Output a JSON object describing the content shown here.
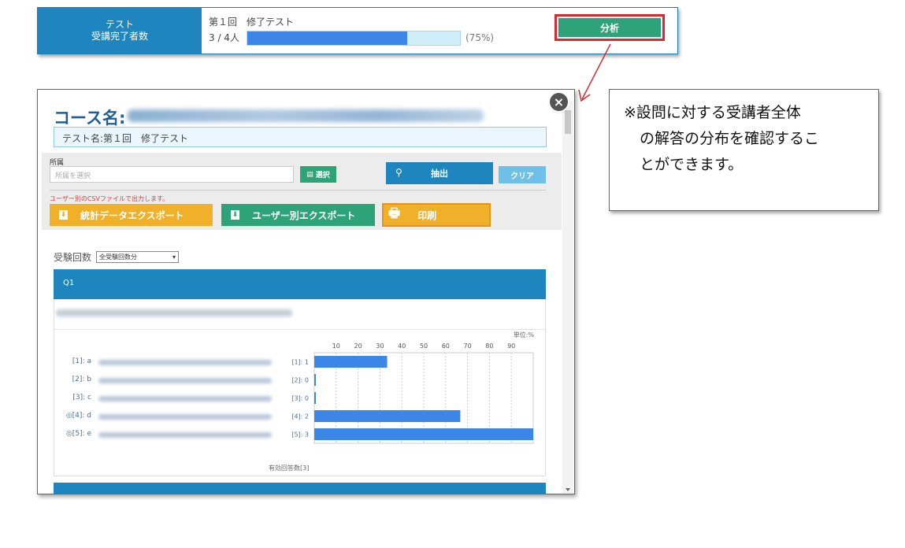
{
  "summary": {
    "label_line1": "テスト",
    "label_line2": "受講完了者数",
    "test_name": "第１回　修了テスト",
    "count": "3 / 4人",
    "progress_fraction": 0.75,
    "percent_text": "(75%)",
    "analyze_label": "分析"
  },
  "modal": {
    "close_glyph": "×",
    "course_prefix": "コース名:",
    "test_name": "テスト名:第１回　修了テスト",
    "filter": {
      "affiliation_label": "所属",
      "affiliation_placeholder": "所属を選択",
      "select_label": "選択",
      "extract_label": "抽出",
      "clear_label": "クリア",
      "csv_note": "ユーザー別のCSVファイルで出力します。",
      "stats_export_label": "統計データエクスポート",
      "user_export_label": "ユーザー別エクスポート",
      "print_label": "印刷"
    },
    "attempts_label": "受験回数",
    "attempts_selected": "全受験回数分",
    "question": {
      "title": "Q1",
      "unit_label": "単位:%",
      "answers_count": "有効回答数[3]"
    }
  },
  "chart_data": {
    "type": "bar",
    "orientation": "horizontal",
    "title": "",
    "xlabel": "",
    "ylabel": "",
    "unit": "単位:%",
    "xlim": [
      0,
      100
    ],
    "ticks": [
      10,
      20,
      30,
      40,
      50,
      60,
      70,
      80,
      90
    ],
    "options": [
      {
        "label": "[1]: a",
        "marked": false
      },
      {
        "label": "[2]: b",
        "marked": false
      },
      {
        "label": "[3]: c",
        "marked": false
      },
      {
        "label": "◎[4]: d",
        "marked": true
      },
      {
        "label": "◎[5]: e",
        "marked": true
      }
    ],
    "categories": [
      "[1]: 1",
      "[2]: 0",
      "[3]: 0",
      "[4]: 2",
      "[5]: 3"
    ],
    "values": [
      33.3,
      0,
      0,
      66.7,
      100
    ],
    "grid": true
  },
  "callout": {
    "line1": "※設問に対する受講者全体",
    "line2": "の解答の分布を確認するこ",
    "line3": "とができます。"
  },
  "colors": {
    "primary_blue": "#1f85be",
    "bar_blue": "#3b86e6",
    "green": "#2ea37a",
    "orange": "#f0b02a",
    "highlight_red": "#d7292f"
  }
}
